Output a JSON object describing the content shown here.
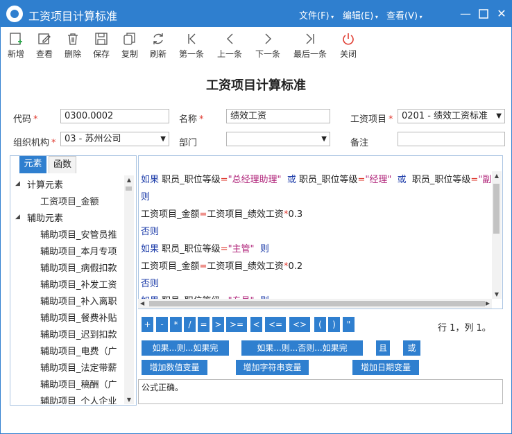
{
  "window": {
    "title": "工资项目计算标准",
    "menus": [
      "文件(F)",
      "编辑(E)",
      "查看(V)"
    ],
    "colors": {
      "titlebar": "#2f7fcf",
      "button": "#2f7fcf",
      "required": "#e03c31",
      "keyword": "#1a3aa8",
      "string": "#b0247a"
    }
  },
  "toolbar": {
    "items": [
      {
        "label": "新增",
        "icon": "new-doc-icon"
      },
      {
        "label": "查看",
        "icon": "edit-view-icon"
      },
      {
        "label": "删除",
        "icon": "trash-icon"
      },
      {
        "label": "保存",
        "icon": "save-icon"
      },
      {
        "label": "复制",
        "icon": "copy-icon"
      },
      {
        "label": "刷新",
        "icon": "refresh-icon"
      },
      {
        "label": "第一条",
        "icon": "first-record-icon"
      },
      {
        "label": "上一条",
        "icon": "prev-record-icon"
      },
      {
        "label": "下一条",
        "icon": "next-record-icon"
      },
      {
        "label": "最后一条",
        "icon": "last-record-icon"
      },
      {
        "label": "关闭",
        "icon": "power-icon"
      }
    ]
  },
  "page_title": "工资项目计算标准",
  "form": {
    "code_label": "代码",
    "code_value": "0300.0002",
    "name_label": "名称",
    "name_value": "绩效工资",
    "salary_item_label": "工资项目",
    "salary_item_value": "0201 - 绩效工资标准",
    "org_label": "组织机构",
    "org_value": "03 - 苏州公司",
    "dept_label": "部门",
    "dept_value": "",
    "remark_label": "备注",
    "remark_value": "",
    "required_mark": "*"
  },
  "tabs": [
    "元素",
    "函数"
  ],
  "tree": {
    "groups": [
      {
        "label": "计算元素",
        "children": [
          "工资项目_金额"
        ]
      },
      {
        "label": "辅助元素",
        "children": [
          "辅助项目_安管员推",
          "辅助项目_本月专项",
          "辅助项目_病假扣款",
          "辅助项目_补发工资",
          "辅助项目_补入离职",
          "辅助项目_餐费补贴",
          "辅助项目_迟到扣款",
          "辅助项目_电费（广",
          "辅助项目_法定带薪",
          "辅助项目_稿酬（广",
          "辅助项目_个人企业"
        ]
      }
    ]
  },
  "formula": {
    "kw_if": "如果",
    "kw_then": "则",
    "kw_else": "否则",
    "kw_or": "或",
    "field_level": "职员_职位等级",
    "field_amount": "工资项目_金额",
    "field_perf": "工资项目_绩效工资",
    "eq": "=",
    "mul": "*",
    "v_gm": "\"总经理助理\"",
    "v_mgr": "\"经理\"",
    "v_vice": "\"副总",
    "v_sup": "\"主管\"",
    "v_staff": "\"专员\"",
    "n1": "0.3",
    "n2": "0.2"
  },
  "operators": [
    "+",
    "-",
    "*",
    "/",
    "=",
    ">",
    ">=",
    "<",
    "<=",
    "<>",
    "(",
    ")",
    "\""
  ],
  "cursor_position": "行 1，列 1。",
  "actions": {
    "if_then": "如果...则...如果完",
    "if_then_else": "如果...则...否则...如果完",
    "and": "且",
    "or": "或",
    "add_number_var": "增加数值变量",
    "add_string_var": "增加字符串变量",
    "add_date_var": "增加日期变量"
  },
  "status_message": "公式正确。"
}
